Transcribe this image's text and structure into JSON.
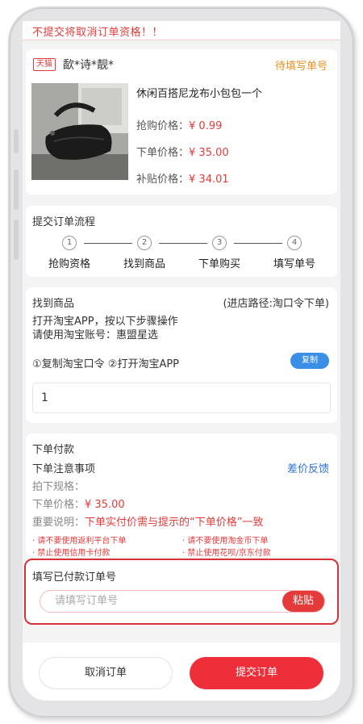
{
  "warning": "不提交将取消订单资格！！",
  "order": {
    "shop_tag": "天猫",
    "shop_name": "歃*诗*靓*",
    "status": "待填写单号",
    "product_title": "休闲百搭尼龙布小包包一个",
    "grab_price_label": "抢购价格：",
    "grab_price": "¥ 0.99",
    "order_price_label": "下单价格：",
    "order_price": "¥ 35.00",
    "subsidy_price_label": "补贴价格：",
    "subsidy_price": "¥ 34.01"
  },
  "flow": {
    "title": "提交订单流程",
    "steps": [
      {
        "num": "1",
        "label": "抢购资格"
      },
      {
        "num": "2",
        "label": "找到商品"
      },
      {
        "num": "3",
        "label": "下单购买"
      },
      {
        "num": "4",
        "label": "填写单号"
      }
    ]
  },
  "find": {
    "title": "找到商品",
    "path": "(进店路径:淘口令下单)",
    "line1": "打开淘宝APP，按以下步骤操作",
    "line2": "请使用淘宝账号：惠盟星选",
    "steps_text": "①复制淘宝口令 ②打开淘宝APP",
    "copy_label": "复制",
    "code_value": "1"
  },
  "payment": {
    "title": "下单付款",
    "notice_title": "下单注意事项",
    "feedback": "差价反馈",
    "spec_label": "拍下规格：",
    "price_label": "下单价格：",
    "price_value": "¥ 35.00",
    "important_label": "重要说明：",
    "important_value": "下单实付价需与提示的“下单价格”一致",
    "rules": [
      "· 请不要使用返利平台下单",
      "· 请不要使用淘金币下单",
      "· 禁止使用信用卡付款",
      "· 禁止使用花呗/京东付款"
    ]
  },
  "fill": {
    "title": "填写已付款订单号",
    "placeholder": "请填写订单号",
    "paste_label": "粘贴"
  },
  "actions": {
    "cancel": "取消订单",
    "submit": "提交订单"
  },
  "colors": {
    "accent_red": "#e43a3a",
    "status_orange": "#e8911f",
    "link_blue": "#2d6fd6",
    "copy_blue": "#3a8ee6"
  }
}
